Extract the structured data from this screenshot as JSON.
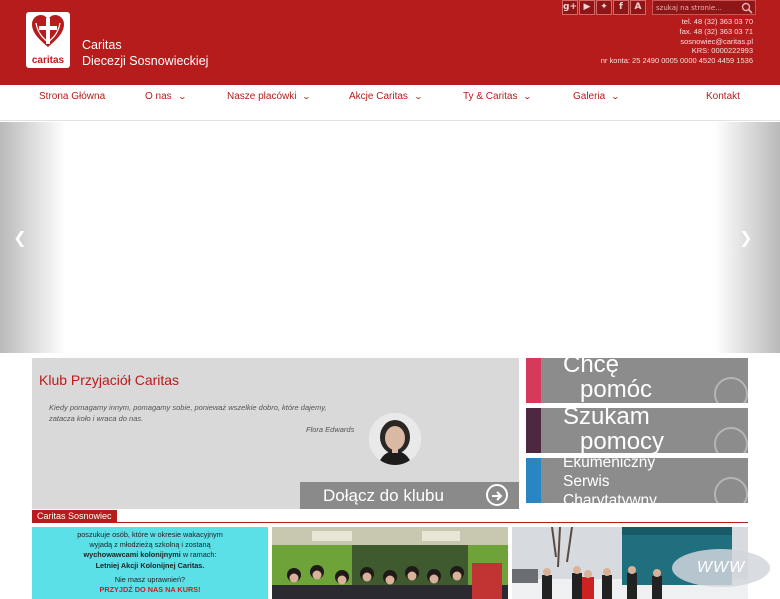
{
  "header": {
    "logo_text": "caritas",
    "org_line1": "Caritas",
    "org_line2": "Diecezji Sosnowieckiej",
    "search_placeholder": "szukaj na stronie...",
    "social": [
      "g+",
      "youtube",
      "twitter",
      "f",
      "A"
    ],
    "contact": {
      "tel": "tel. 48 (32) 363 03 70",
      "fax": "fax. 48 (32) 363 03 71",
      "email": "sosnowiec@caritas.pl",
      "krs": "KRS: 0000222993",
      "account": "nr konta: 25 2490 0005 0000 4520 4459 1536"
    }
  },
  "nav": {
    "items": [
      {
        "label": "Strona Główna"
      },
      {
        "label": "O nas"
      },
      {
        "label": "Nasze placówki"
      },
      {
        "label": "Akcje Caritas"
      },
      {
        "label": "Ty & Caritas"
      },
      {
        "label": "Galeria"
      },
      {
        "label": "Kontakt"
      }
    ]
  },
  "slider": {
    "prev_icon": "chevron-left-icon",
    "next_icon": "chevron-right-icon"
  },
  "club": {
    "title": "Klub Przyjaciół Caritas",
    "quote": "Kiedy pomagamy innym, pomagamy sobie, ponieważ wszelkie dobro, które dajemy, zatacza koło i wraca do nas.",
    "author": "Flora Edwards",
    "button": "Dołącz do klubu"
  },
  "tiles": [
    {
      "line1": "Chcę",
      "line2": "pomóc",
      "color": "#d63a5a"
    },
    {
      "line1": "Szukam",
      "line2": "pomocy",
      "color": "#4e2740"
    },
    {
      "line1": "Ekumeniczny",
      "line2": "Serwis",
      "line3": "Charytatywny",
      "color": "#2a86c2"
    }
  ],
  "news": {
    "section_label": "Caritas Sosnowiec",
    "card1": {
      "l1": "poszukuje osób, które w okresie wakacyjnym",
      "l2": "wyjadą z młodzieżą szkolną i zostaną",
      "l3a": "wychowawcami kolonijnymi",
      "l3b": " w ramach:",
      "l4": "Letniej Akcji Kolonijnej Caritas.",
      "l5": "Nie masz uprawnień?",
      "l6": "PRZYJDŹ DO NAS NA KURS!"
    },
    "badge": "WWW"
  },
  "colors": {
    "brand_red": "#b71c1c",
    "tile_grey": "#8c8c8c",
    "club_bg": "#d9d9d9"
  }
}
